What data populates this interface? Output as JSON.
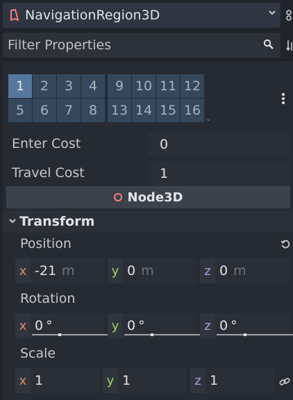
{
  "node_selector": {
    "title": "NavigationRegion3D",
    "icon": "navigation-region-icon",
    "dropdown_icon": "chevron-down-icon"
  },
  "filter": {
    "placeholder": "Filter Properties",
    "icon": "search-icon"
  },
  "layers": {
    "row1": [
      "1",
      "2",
      "3",
      "4",
      "9",
      "10",
      "11",
      "12"
    ],
    "row2": [
      "5",
      "6",
      "7",
      "8",
      "13",
      "14",
      "15",
      "16"
    ],
    "enabled": [
      "1"
    ]
  },
  "enter_cost": {
    "label": "Enter Cost",
    "value": "0"
  },
  "travel_cost": {
    "label": "Travel Cost",
    "value": "1"
  },
  "section": {
    "title": "Node3D"
  },
  "transform": {
    "title": "Transform",
    "position": {
      "label": "Position",
      "x": "-21",
      "y": "0",
      "z": "0",
      "unit": "m"
    },
    "rotation": {
      "label": "Rotation",
      "x": "0",
      "y": "0",
      "z": "0",
      "unit": "°"
    },
    "scale": {
      "label": "Scale",
      "x": "1",
      "y": "1",
      "z": "1"
    }
  },
  "axes": {
    "x": "x",
    "y": "y",
    "z": "z"
  },
  "colors": {
    "accent": "#56789e",
    "axis_x": "#e0896d",
    "axis_y": "#9fd85f",
    "axis_z": "#a99ae6",
    "node_ring": "#fc7f7f"
  }
}
